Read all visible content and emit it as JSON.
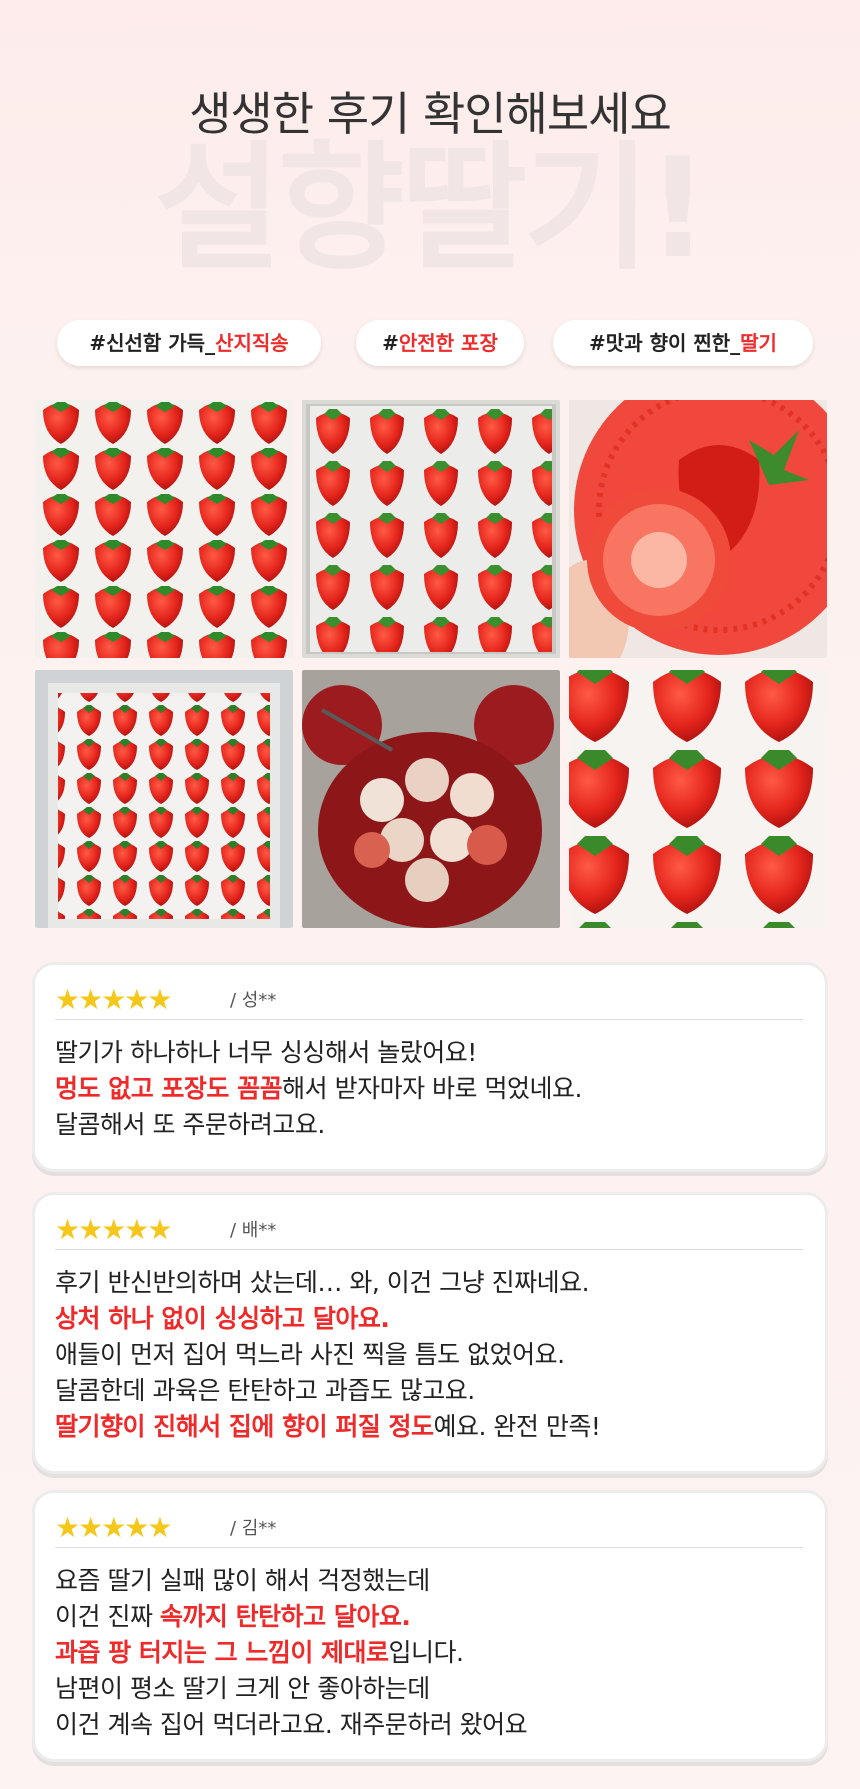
{
  "header": {
    "headline": "생생한 후기 확인해보세요",
    "watermark": "설향딸기!"
  },
  "tags": [
    {
      "prefix": "#신선함 가득_",
      "highlight": "산지직송"
    },
    {
      "prefix": "#",
      "highlight": "안전한 포장"
    },
    {
      "prefix": "#맛과 향이 찐한_",
      "highlight": "딸기"
    }
  ],
  "photos": [
    {
      "icon": "strawberries-in-tray-photo"
    },
    {
      "icon": "strawberries-in-box-photo"
    },
    {
      "icon": "strawberry-cut-in-basket-photo"
    },
    {
      "icon": "strawberries-packed-box-photo"
    },
    {
      "icon": "strawberries-on-red-plate-photo"
    },
    {
      "icon": "strawberries-closeup-photo"
    }
  ],
  "reviews": [
    {
      "stars": "★★★★★",
      "author": "/ 성**",
      "lines": [
        [
          {
            "t": "딸기가 하나하나 너무 싱싱해서 놀랐어요!"
          }
        ],
        [
          {
            "t": "멍도 없고 포장도 꼼꼼",
            "em": true
          },
          {
            "t": "해서 받자마자 바로 먹었네요."
          }
        ],
        [
          {
            "t": "달콤해서 또 주문하려고요."
          }
        ]
      ]
    },
    {
      "stars": "★★★★★",
      "author": "/ 배**",
      "lines": [
        [
          {
            "t": "후기 반신반의하며 샀는데… 와, 이건 그냥 진짜네요."
          }
        ],
        [
          {
            "t": "상처 하나 없이 싱싱하고 달아요.",
            "em": true
          }
        ],
        [
          {
            "t": "애들이 먼저 집어 먹느라 사진 찍을 틈도 없었어요."
          }
        ],
        [
          {
            "t": "달콤한데 과육은 탄탄하고 과즙도 많고요."
          }
        ],
        [
          {
            "t": "딸기향이 진해서 집에 향이 퍼질 정도",
            "em": true
          },
          {
            "t": "예요. 완전 만족!"
          }
        ]
      ]
    },
    {
      "stars": "★★★★★",
      "author": "/ 김**",
      "lines": [
        [
          {
            "t": "요즘 딸기 실패 많이 해서 걱정했는데"
          }
        ],
        [
          {
            "t": "이건 진짜 "
          },
          {
            "t": "속까지 탄탄하고 달아요.",
            "em": true
          }
        ],
        [
          {
            "t": "과즙 팡 터지는 그 느낌이 제대로",
            "em": true
          },
          {
            "t": "입니다."
          }
        ],
        [
          {
            "t": "남편이 평소 딸기 크게 안 좋아하는데"
          }
        ],
        [
          {
            "t": "이건 계속 집어 먹더라고요. 재주문하러 왔어요"
          }
        ]
      ]
    }
  ],
  "colors": {
    "accent": "#ee2a2a",
    "star": "#f5c71a",
    "background": "#fdf1f0"
  }
}
